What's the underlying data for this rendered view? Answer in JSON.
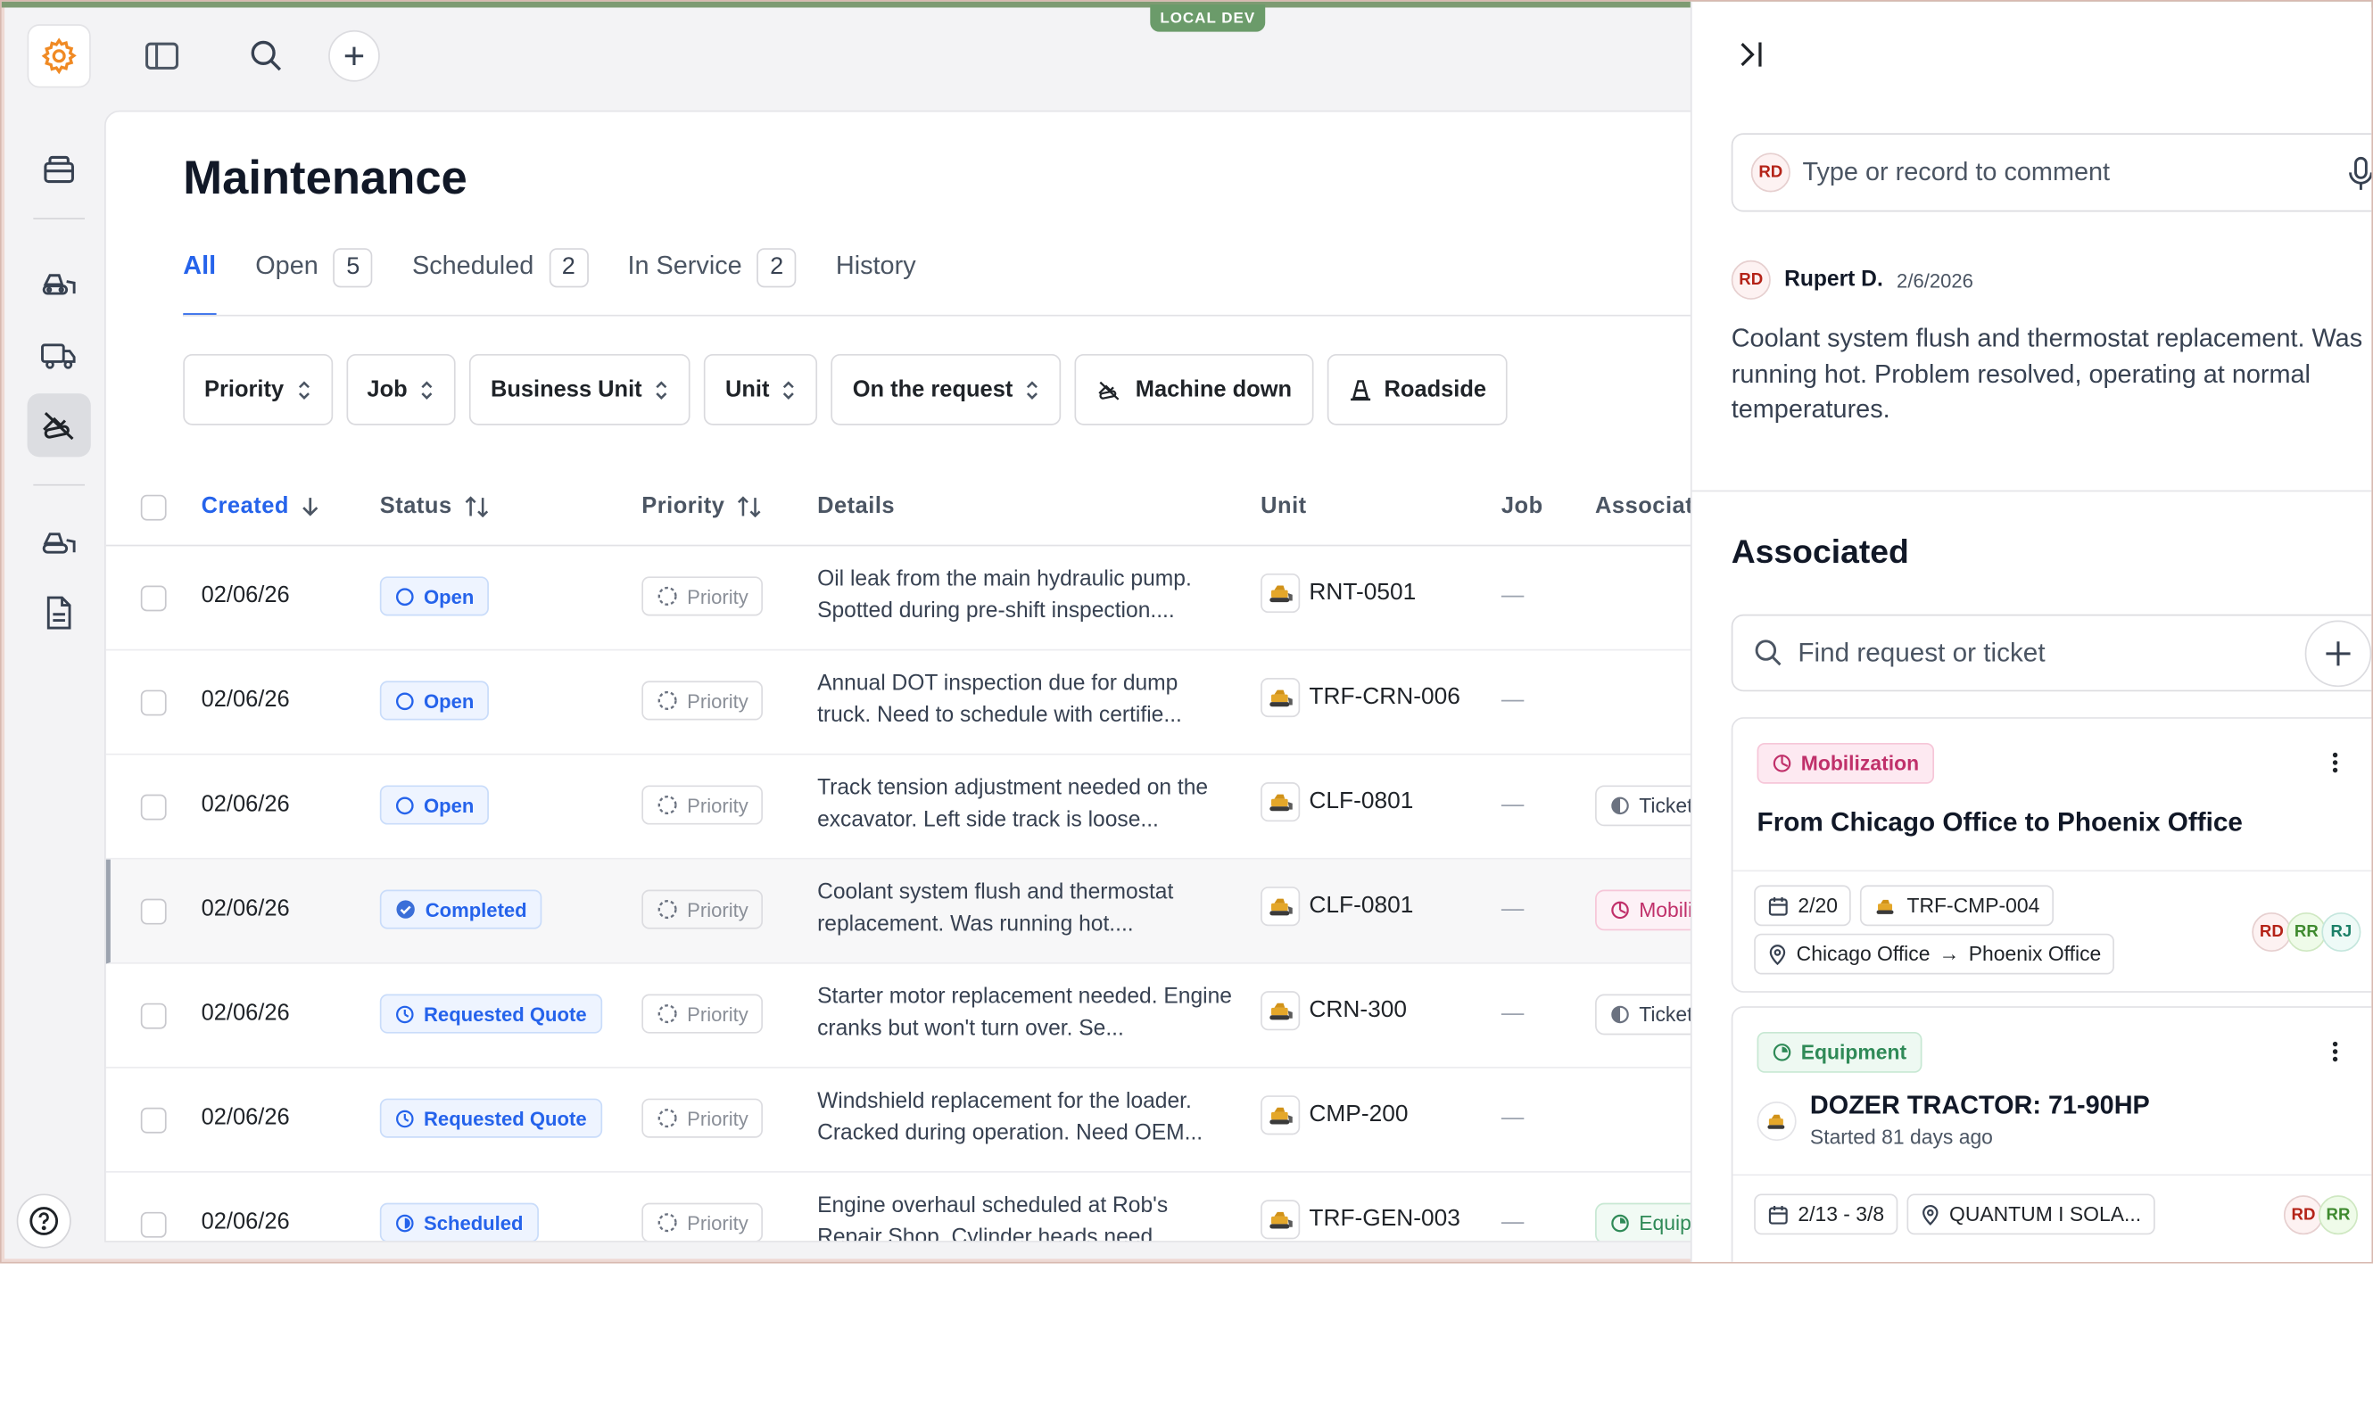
{
  "env_badge": "LOCAL DEV",
  "page_title": "Maintenance",
  "tabs": [
    {
      "label": "All",
      "count": ""
    },
    {
      "label": "Open",
      "count": "5"
    },
    {
      "label": "Scheduled",
      "count": "2"
    },
    {
      "label": "In Service",
      "count": "2"
    },
    {
      "label": "History",
      "count": ""
    }
  ],
  "filters": {
    "priority": "Priority",
    "job": "Job",
    "business_unit": "Business Unit",
    "unit": "Unit",
    "on_request": "On the request",
    "machine_down": "Machine down",
    "roadside": "Roadside"
  },
  "columns": {
    "created": "Created",
    "status": "Status",
    "priority": "Priority",
    "details": "Details",
    "unit": "Unit",
    "job": "Job",
    "associated": "Associat"
  },
  "rows": [
    {
      "date": "02/06/26",
      "status": "Open",
      "priority": "Priority",
      "details": "Oil leak from the main hydraulic pump. Spotted during pre-shift inspection....",
      "unit": "RNT-0501",
      "job": "—",
      "assoc": ""
    },
    {
      "date": "02/06/26",
      "status": "Open",
      "priority": "Priority",
      "details": "Annual DOT inspection due for dump truck. Need to schedule with certifie...",
      "unit": "TRF-CRN-006",
      "job": "—",
      "assoc": ""
    },
    {
      "date": "02/06/26",
      "status": "Open",
      "priority": "Priority",
      "details": "Track tension adjustment needed on the excavator. Left side track is loose...",
      "unit": "CLF-0801",
      "job": "—",
      "assoc": "Ticket"
    },
    {
      "date": "02/06/26",
      "status": "Completed",
      "priority": "Priority",
      "details": "Coolant system flush and thermostat replacement. Was running hot....",
      "unit": "CLF-0801",
      "job": "—",
      "assoc": "Mobili"
    },
    {
      "date": "02/06/26",
      "status": "Requested Quote",
      "priority": "Priority",
      "details": "Starter motor replacement needed. Engine cranks but won't turn over. Se...",
      "unit": "CRN-300",
      "job": "—",
      "assoc": "Ticket"
    },
    {
      "date": "02/06/26",
      "status": "Requested Quote",
      "priority": "Priority",
      "details": "Windshield replacement for the loader. Cracked during operation. Need OEM...",
      "unit": "CMP-200",
      "job": "—",
      "assoc": ""
    },
    {
      "date": "02/06/26",
      "status": "Scheduled",
      "priority": "Priority",
      "details": "Engine overhaul scheduled at Rob's Repair Shop. Cylinder heads need...",
      "unit": "TRF-GEN-003",
      "job": "—",
      "assoc": "Equip"
    }
  ],
  "side": {
    "comment_avatar": "RD",
    "comment_placeholder": "Type or record to comment",
    "comment": {
      "avatar": "RD",
      "author": "Rupert D.",
      "date": "2/6/2026",
      "body": "Coolant system flush and thermostat replacement. Was running hot. Problem resolved, operating at normal temperatures."
    },
    "associated_title": "Associated",
    "find_placeholder": "Find request or ticket",
    "card1": {
      "badge": "Mobilization",
      "title": "From Chicago Office to Phoenix Office",
      "date_chip": "2/20",
      "unit_chip": "TRF-CMP-004",
      "route_from": "Chicago Office",
      "route_arrow": "→",
      "route_to": "Phoenix Office",
      "avatars": [
        "RD",
        "RR",
        "RJ"
      ]
    },
    "card2": {
      "badge": "Equipment",
      "name": "DOZER TRACTOR: 71-90HP",
      "sub": "Started 81 days ago",
      "date_chip": "2/13 - 3/8",
      "location_chip": "QUANTUM I SOLA...",
      "avatars": [
        "RD",
        "RR"
      ]
    }
  },
  "colors": {
    "accent": "#2563eb",
    "env_badge": "#6b9b6a",
    "mobilization": "#c0306a",
    "equipment": "#2f8a57",
    "logo": "#f08a24"
  }
}
